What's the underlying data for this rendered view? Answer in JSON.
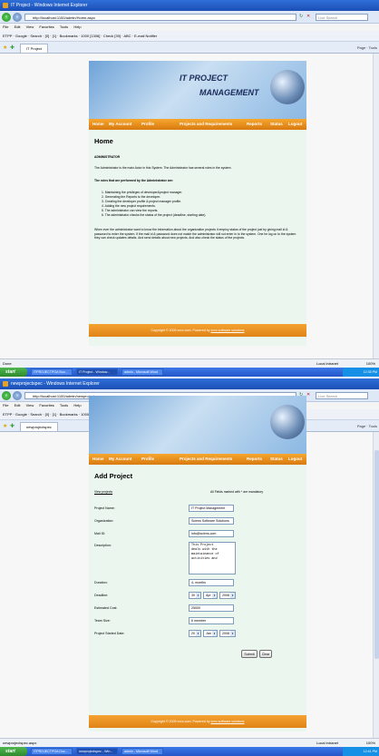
{
  "window1": {
    "title": "IT Project - Windows Internet Explorer",
    "address": "http://localhost:1100/admin/Home.aspx",
    "search_placeholder": "Live Search",
    "menu": [
      "File",
      "Edit",
      "View",
      "Favorites",
      "Tools",
      "Help"
    ],
    "toolbar_text": "ETPP  ·  Google  ·  Search  ·  [0]  ·  [1]  ·  Bookmarks  ·  1000 [1306]  ·  Check [39]  ·  ABC  ·  E-mail Notifier",
    "tab_label": "IT Project",
    "tab_tools": "Page  ·  Tools",
    "status_left": "Done",
    "status_zone": "Local intranet",
    "status_zoom": "100%"
  },
  "site1": {
    "header_line1": "IT PROJECT",
    "header_line2": "MANAGEMENT",
    "nav": {
      "home": "Home",
      "account": "My Account",
      "profile": "Profile",
      "projects": "Projects and Requirements",
      "reports": "Reports",
      "status": "Status",
      "logout": "Logout"
    },
    "page_title": "Home",
    "section_heading": "ADMINISTRATOR",
    "intro": "The Administrator is the main Actor in this System. The Administrator has several roles in the system.",
    "roles_heading": "The roles that are performed by the Administrator are:",
    "roles": [
      "1.   Maintaining the privileges of developer&project manager.",
      "2.   Generating the Reports to the developer.",
      "3.   Creating the developer profile & project manager profile.",
      "4.   Adding the new project requirements.",
      "5.   The administrator can view the reports.",
      "6.   The administrator checks the status of the project (deadline, starting date)."
    ],
    "para": "When ever the administrator want to know the information about the organization projects it employ status of the project just by giving mail id & password to enter the system. If the mail id & password does not match the administrator will not enter in to the system. One he log on to the system they can check updates details. And send details about new projects. And also check the status of the projects.",
    "footer_text": "Copyright © 2009 xxxx.com. Powered by",
    "footer_link": "xxxx software solutions"
  },
  "taskbar1": {
    "start": "start",
    "buttons": [
      "ITPROJECTPOA Boo...",
      "IT Project - Window...",
      "admin - Microsoft Word"
    ],
    "clock": "12:35 PM"
  },
  "window2": {
    "title": "newprojectspec - Windows Internet Explorer",
    "address": "http://localhost:1100/admin/newprojectspec.aspx",
    "search_placeholder": "Live Search",
    "menu": [
      "File",
      "Edit",
      "View",
      "Favorites",
      "Tools",
      "Help"
    ],
    "toolbar_text": "ETPP  ·  Google  ·  Search  ·  [0]  ·  [1]  ·  Bookmarks  ·  1000 [1326]  ·  Check [39]  ·  ABC  ·  E-mail Notifier",
    "tab_label": "newprojectspec",
    "tab_tools": "Page  ·  Tools",
    "status_left": "newprojectspec.aspx",
    "status_zone": "Local intranet",
    "status_zoom": "100%"
  },
  "site2": {
    "nav": {
      "home": "Home",
      "account": "My Account",
      "profile": "Profile",
      "projects": "Projects and Requirements",
      "reports": "Reports",
      "status": "Status",
      "logout": "Logout"
    },
    "page_title": "Add Project",
    "view_projects": "View projects",
    "note": "All Fields marked with * are mandatory",
    "labels": {
      "project_name": "Project Name:",
      "organization": "Organization:",
      "mail": "Mail ID:",
      "description": "Description:",
      "duration": "Duration:",
      "deadline": "Deadline:",
      "cost": "Estimated Cost:",
      "team": "Team Size:",
      "start": "Project Started Date:"
    },
    "values": {
      "project_name": "IT Project Management",
      "organization": "Sciens Software Solutions",
      "mail": "info@sciens.com",
      "description": "This Project\ndeals with the\nmaintainance of\nactivities and",
      "duration": "4- months",
      "deadline_day": "30",
      "deadline_month": "Apr",
      "deadline_year": "2008",
      "cost": "25000",
      "team": "6 member",
      "start_day": "20",
      "start_month": "Jan",
      "start_year": "2008"
    },
    "submit": "Submit",
    "clear": "Clear",
    "footer_text": "Copyright © 2009 xxxx.com. Powered by",
    "footer_link": "xxxx software solutions"
  },
  "taskbar2": {
    "start": "start",
    "buttons": [
      "ITPROJECTPOA Doc...",
      "newprojectspec - Win...",
      "admin - Microsoft Word"
    ],
    "clock": "12:41 PM"
  }
}
